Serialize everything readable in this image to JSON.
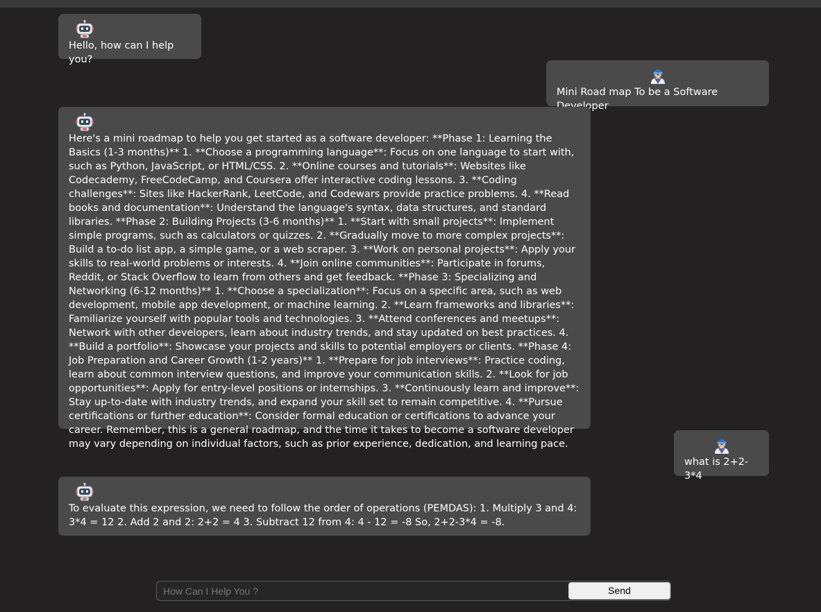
{
  "messages": {
    "bot_greeting": "Hello, how can I help you?",
    "user_q1": "Mini Road map To be a Software Developer",
    "bot_answer1": "Here's a mini roadmap to help you get started as a software developer: **Phase 1: Learning the Basics (1-3 months)** 1. **Choose a programming language**: Focus on one language to start with, such as Python, JavaScript, or HTML/CSS. 2. **Online courses and tutorials**: Websites like Codecademy, FreeCodeCamp, and Coursera offer interactive coding lessons. 3. **Coding challenges**: Sites like HackerRank, LeetCode, and Codewars provide practice problems. 4. **Read books and documentation**: Understand the language's syntax, data structures, and standard libraries. **Phase 2: Building Projects (3-6 months)** 1. **Start with small projects**: Implement simple programs, such as calculators or quizzes. 2. **Gradually move to more complex projects**: Build a to-do list app, a simple game, or a web scraper. 3. **Work on personal projects**: Apply your skills to real-world problems or interests. 4. **Join online communities**: Participate in forums, Reddit, or Stack Overflow to learn from others and get feedback. **Phase 3: Specializing and Networking (6-12 months)** 1. **Choose a specialization**: Focus on a specific area, such as web development, mobile app development, or machine learning. 2. **Learn frameworks and libraries**: Familiarize yourself with popular tools and technologies. 3. **Attend conferences and meetups**: Network with other developers, learn about industry trends, and stay updated on best practices. 4. **Build a portfolio**: Showcase your projects and skills to potential employers or clients. **Phase 4: Job Preparation and Career Growth (1-2 years)** 1. **Prepare for job interviews**: Practice coding, learn about common interview questions, and improve your communication skills. 2. **Look for job opportunities**: Apply for entry-level positions or internships. 3. **Continuously learn and improve**: Stay up-to-date with industry trends, and expand your skill set to remain competitive. 4. **Pursue certifications or further education**: Consider formal education or certifications to advance your career. Remember, this is a general roadmap, and the time it takes to become a software developer may vary depending on individual factors, such as prior experience, dedication, and learning pace.",
    "user_q2": "what is 2+2-3*4",
    "bot_answer2": "To evaluate this expression, we need to follow the order of operations (PEMDAS): 1. Multiply 3 and 4: 3*4 = 12 2. Add 2 and 2: 2+2 = 4 3. Subtract 12 from 4: 4 - 12 = -8 So, 2+2-3*4 = -8."
  },
  "icons": {
    "bot": "robot-icon",
    "user": "user-avatar-icon"
  },
  "input": {
    "placeholder": "How Can I Help You ?",
    "value": ""
  },
  "send_label": "Send",
  "colors": {
    "background": "#232122",
    "bubble": "#4a4a4b",
    "topbar": "#3a3a3d",
    "send_button": "#f0f0f0"
  }
}
